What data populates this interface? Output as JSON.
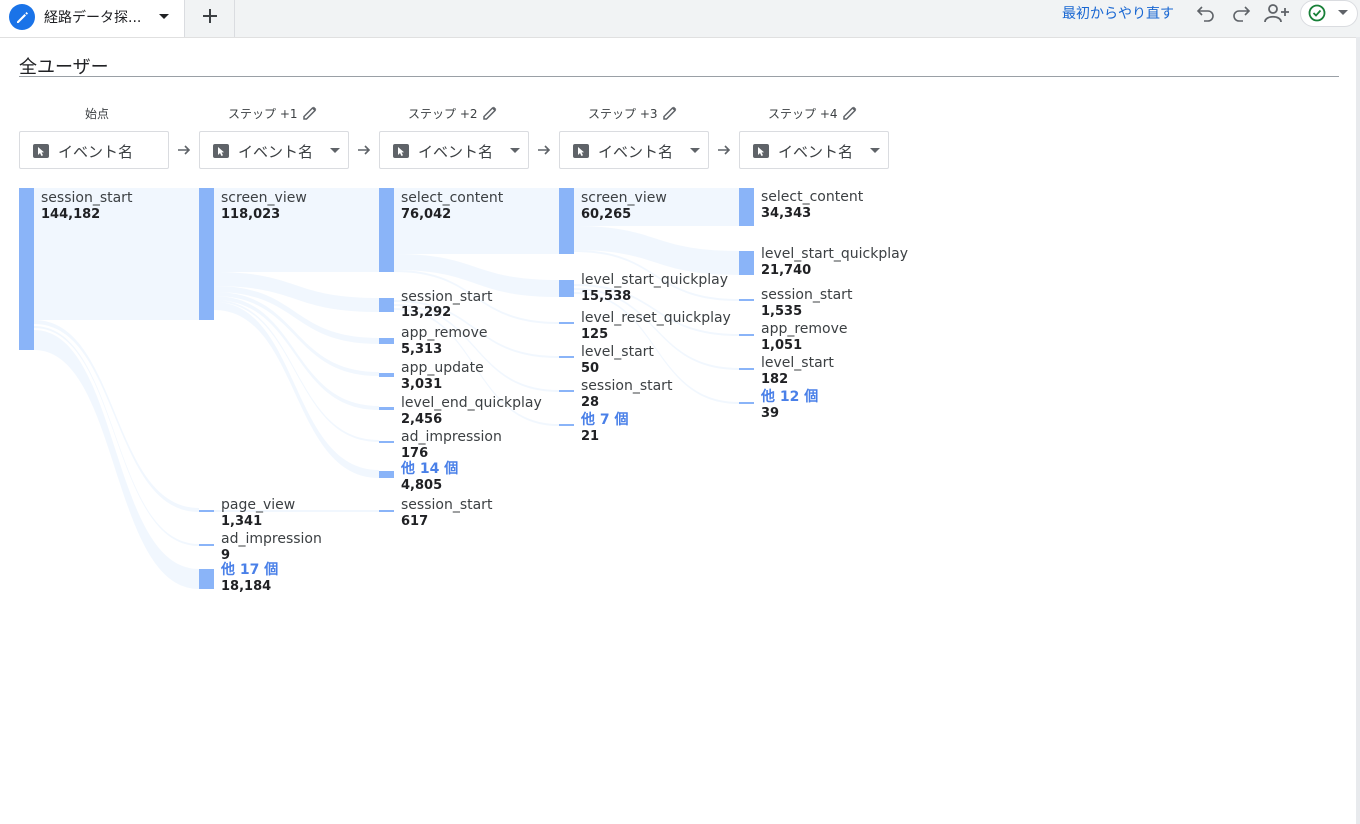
{
  "tab": {
    "title": "経路データ探...",
    "icon": "pencil-icon"
  },
  "toolbar": {
    "restart_label": "最初からやり直す",
    "icons": [
      "undo-icon",
      "redo-icon",
      "share-user-icon",
      "check-circle-icon"
    ]
  },
  "segment": {
    "title": "全ユーザー"
  },
  "steps": [
    {
      "header": "始点",
      "dimension": "イベント名"
    },
    {
      "header": "ステップ +1",
      "dimension": "イベント名"
    },
    {
      "header": "ステップ +2",
      "dimension": "イベント名"
    },
    {
      "header": "ステップ +3",
      "dimension": "イベント名"
    },
    {
      "header": "ステップ +4",
      "dimension": "イベント名"
    }
  ],
  "nodes": {
    "c0n0": {
      "name": "session_start",
      "count": "144,182"
    },
    "c1n0": {
      "name": "screen_view",
      "count": "118,023"
    },
    "c1n1": {
      "name": "page_view",
      "count": "1,341"
    },
    "c1n2": {
      "name": "ad_impression",
      "count": "9"
    },
    "c1n3": {
      "name": "他 17 個",
      "count": "18,184"
    },
    "c2n0": {
      "name": "select_content",
      "count": "76,042"
    },
    "c2n1": {
      "name": "session_start",
      "count": "13,292"
    },
    "c2n2": {
      "name": "app_remove",
      "count": "5,313"
    },
    "c2n3": {
      "name": "app_update",
      "count": "3,031"
    },
    "c2n4": {
      "name": "level_end_quickplay",
      "count": "2,456"
    },
    "c2n5": {
      "name": "ad_impression",
      "count": "176"
    },
    "c2n6": {
      "name": "他 14 個",
      "count": "4,805"
    },
    "c2n7": {
      "name": "session_start",
      "count": "617"
    },
    "c3n0": {
      "name": "screen_view",
      "count": "60,265"
    },
    "c3n1": {
      "name": "level_start_quickplay",
      "count": "15,538"
    },
    "c3n2": {
      "name": "level_reset_quickplay",
      "count": "125"
    },
    "c3n3": {
      "name": "level_start",
      "count": "50"
    },
    "c3n4": {
      "name": "session_start",
      "count": "28"
    },
    "c3n5": {
      "name": "他 7 個",
      "count": "21"
    },
    "c4n0": {
      "name": "select_content",
      "count": "34,343"
    },
    "c4n1": {
      "name": "level_start_quickplay",
      "count": "21,740"
    },
    "c4n2": {
      "name": "session_start",
      "count": "1,535"
    },
    "c4n3": {
      "name": "app_remove",
      "count": "1,051"
    },
    "c4n4": {
      "name": "level_start",
      "count": "182"
    },
    "c4n5": {
      "name": "他 12 個",
      "count": "39"
    }
  }
}
